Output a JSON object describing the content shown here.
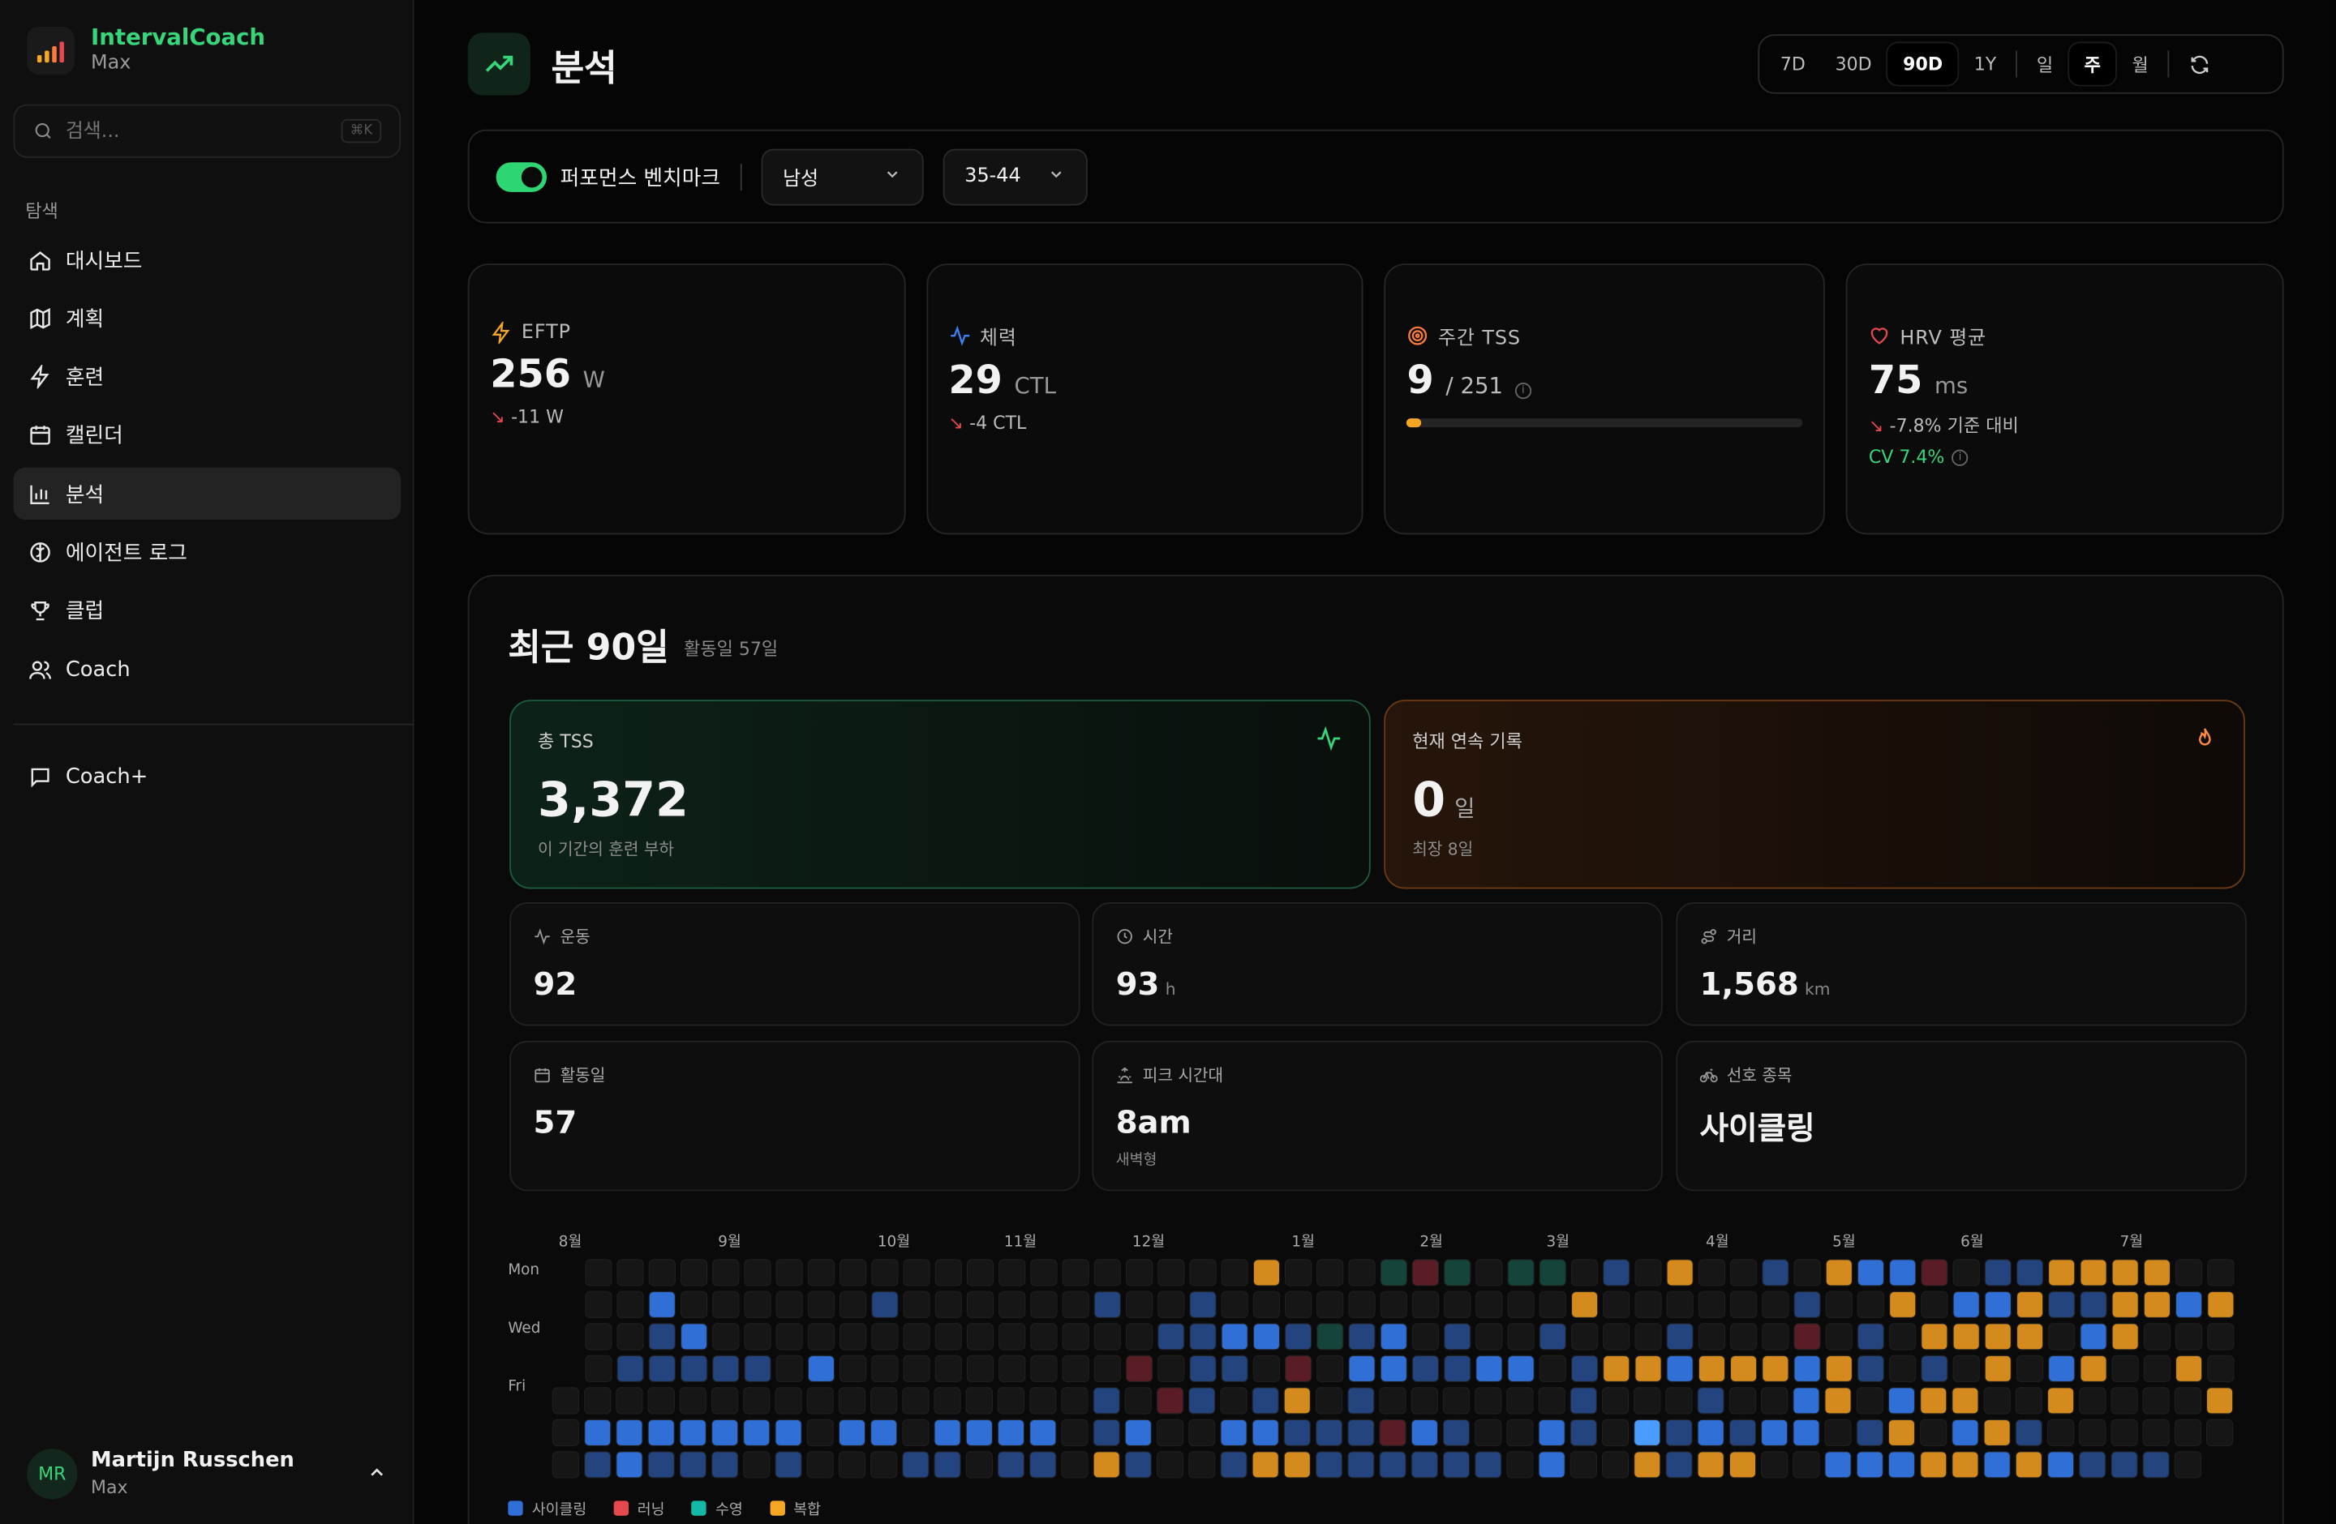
{
  "app": {
    "name": "IntervalCoach",
    "sub": "Max"
  },
  "search": {
    "placeholder": "검색...",
    "kbd": "⌘K"
  },
  "nav": {
    "heading": "탐색",
    "items": [
      {
        "label": "대시보드",
        "icon": "home-icon"
      },
      {
        "label": "계획",
        "icon": "map-icon"
      },
      {
        "label": "훈련",
        "icon": "bolt-icon"
      },
      {
        "label": "캘린더",
        "icon": "calendar-icon"
      },
      {
        "label": "분석",
        "icon": "bar-chart-icon",
        "active": true
      },
      {
        "label": "에이전트 로그",
        "icon": "brain-icon"
      },
      {
        "label": "클럽",
        "icon": "trophy-icon"
      },
      {
        "label": "Coach",
        "icon": "users-icon"
      }
    ],
    "extra": {
      "label": "Coach+",
      "icon": "message-icon"
    }
  },
  "user": {
    "initials": "MR",
    "name": "Martijn Russchen",
    "sub": "Max"
  },
  "page": {
    "title": "분석"
  },
  "range": {
    "options": [
      "7D",
      "30D",
      "90D",
      "1Y"
    ],
    "selected": "90D",
    "granularity": [
      "일",
      "주",
      "월"
    ],
    "granularity_selected": "주"
  },
  "benchmark": {
    "label": "퍼포먼스 벤치마크",
    "enabled": true,
    "gender": "남성",
    "age": "35-44"
  },
  "metrics": {
    "eftp": {
      "label": "EFTP",
      "value": "256",
      "unit": "W",
      "delta": "-11 W"
    },
    "fitness": {
      "label": "체력",
      "value": "29",
      "unit": "CTL",
      "delta": "-4 CTL"
    },
    "weekly_tss": {
      "label": "주간 TSS",
      "value": "9",
      "target": "/ 251",
      "progress": 0.036
    },
    "hrv": {
      "label": "HRV 평균",
      "value": "75",
      "unit": "ms",
      "delta": "-7.8% 기준 대비",
      "cv": "CV 7.4%"
    }
  },
  "summary": {
    "title": "최근 90일",
    "subtitle": "활동일 57일",
    "total_tss": {
      "label": "총 TSS",
      "value": "3,372",
      "foot": "이 기간의 훈련 부하"
    },
    "streak": {
      "label": "현재 연속 기록",
      "value": "0",
      "unit": "일",
      "foot": "최장 8일"
    },
    "stats": [
      {
        "label": "운동",
        "value": "92",
        "unit": "",
        "foot": "",
        "icon": "activity-icon"
      },
      {
        "label": "시간",
        "value": "93",
        "unit": "h",
        "foot": "",
        "icon": "clock-icon"
      },
      {
        "label": "거리",
        "value": "1,568",
        "unit": "km",
        "foot": "",
        "icon": "route-icon"
      },
      {
        "label": "활동일",
        "value": "57",
        "unit": "",
        "foot": "",
        "icon": "calendar-icon"
      },
      {
        "label": "피크 시간대",
        "value": "8am",
        "unit": "",
        "foot": "새벽형",
        "icon": "sunrise-icon"
      },
      {
        "label": "선호 종목",
        "value": "사이클링",
        "unit": "",
        "foot": "",
        "icon": "bike-icon"
      }
    ]
  },
  "heatmap": {
    "months": [
      "8월",
      "9월",
      "10월",
      "11월",
      "12월",
      "1월",
      "2월",
      "3월",
      "4월",
      "5월",
      "6월",
      "7월"
    ],
    "days": [
      "Mon",
      "Wed",
      "Fri"
    ],
    "legend": [
      {
        "label": "사이클링",
        "color": "#2f6fd6"
      },
      {
        "label": "러닝",
        "color": "#e5484d"
      },
      {
        "label": "수영",
        "color": "#14b8a6"
      },
      {
        "label": "복합",
        "color": "#f5a623"
      }
    ]
  }
}
